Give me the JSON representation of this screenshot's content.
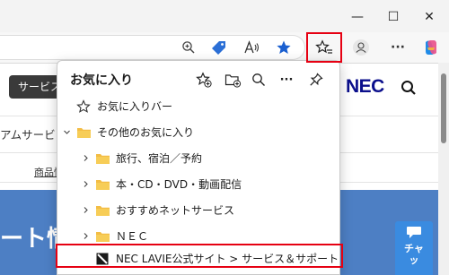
{
  "window": {
    "minimize": "—",
    "maximize": "☐",
    "close": "✕"
  },
  "toolbar": {
    "zoom_icon": "zoom-icon",
    "tag_icon": "tag-icon",
    "read_aloud_icon": "read-aloud-icon",
    "favorite_icon": "star-icon",
    "favorites_icon": "favorites-icon",
    "profile_icon": "profile-icon",
    "more_label": "···",
    "copilot_icon": "copilot-icon",
    "highlight_color": "#e60012"
  },
  "site": {
    "button_label": "サービス",
    "logo": "NEC",
    "nav_text": "アムサービス",
    "crumb_text": "商品情",
    "hero_text": "ート情",
    "chat_label_1": "チャ",
    "chat_label_2": "ッ",
    "hero_color": "#4d7fc4"
  },
  "favorites": {
    "title": "お気に入り",
    "tools": [
      "add-favorite-icon",
      "add-folder-icon",
      "search-icon",
      "more-icon",
      "pin-icon"
    ],
    "more_label": "···",
    "items": [
      {
        "label": "お気に入りバー",
        "icon": "star-outline-icon"
      },
      {
        "label": "その他のお気に入り",
        "icon": "folder-icon",
        "expanded": true
      },
      {
        "label": "旅行、宿泊／予約",
        "icon": "folder-icon"
      },
      {
        "label": "本・CD・DVD・動画配信",
        "icon": "folder-icon"
      },
      {
        "label": "おすすめネットサービス",
        "icon": "folder-icon"
      },
      {
        "label": "ＮＥＣ",
        "icon": "folder-icon"
      },
      {
        "label": "NEC LAVIE公式サイト > サービス＆サポート > ホー",
        "icon": "nec-favicon"
      }
    ]
  }
}
